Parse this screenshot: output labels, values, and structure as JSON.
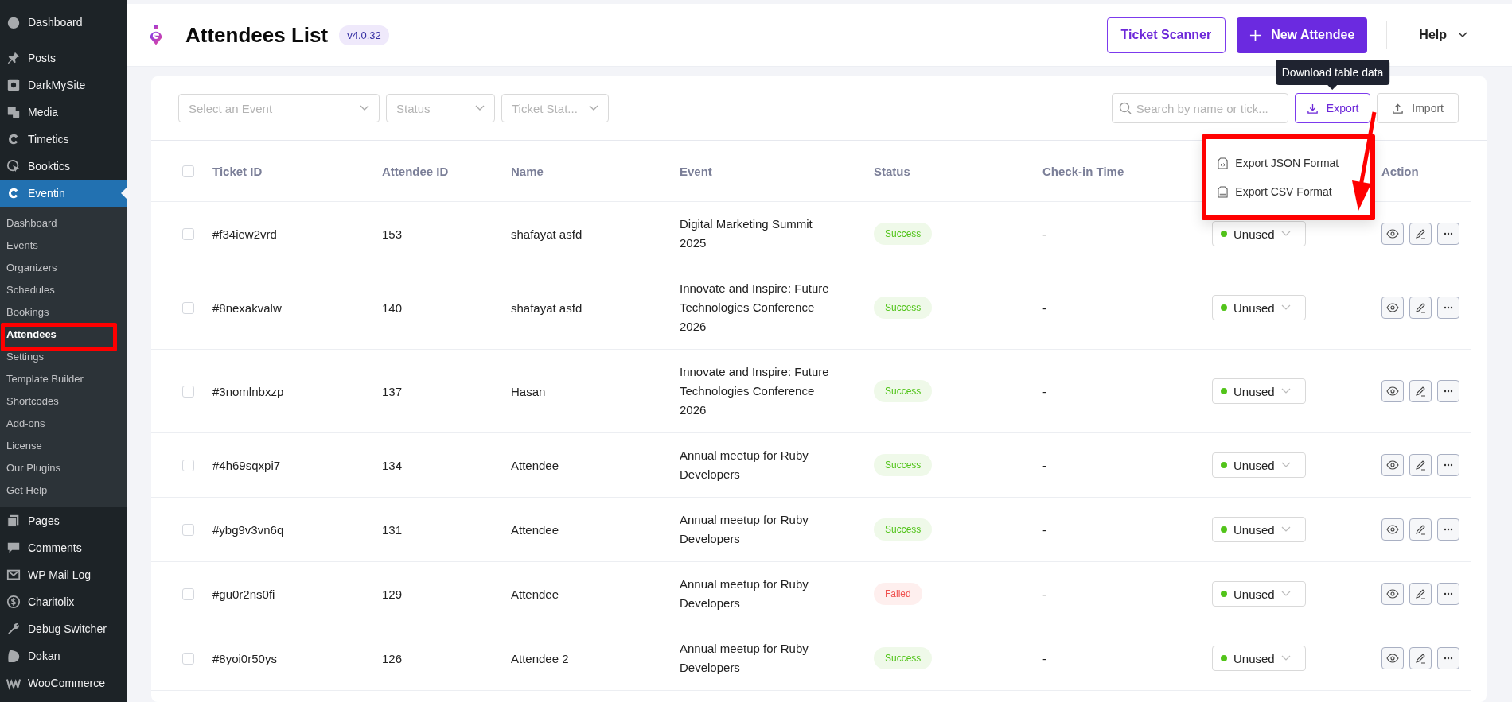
{
  "sidebar": {
    "items": [
      {
        "label": "Dashboard",
        "selected": false
      },
      {
        "label": "Posts",
        "selected": false
      },
      {
        "label": "DarkMySite",
        "selected": false
      },
      {
        "label": "Media",
        "selected": false
      },
      {
        "label": "Timetics",
        "selected": false
      },
      {
        "label": "Booktics",
        "selected": false
      },
      {
        "label": "Eventin",
        "selected": true,
        "children": [
          {
            "label": "Dashboard",
            "selected": false,
            "annotated": false
          },
          {
            "label": "Events",
            "selected": false,
            "annotated": false
          },
          {
            "label": "Organizers",
            "selected": false,
            "annotated": false
          },
          {
            "label": "Schedules",
            "selected": false,
            "annotated": false
          },
          {
            "label": "Bookings",
            "selected": false,
            "annotated": false
          },
          {
            "label": "Attendees",
            "selected": true,
            "annotated": true
          },
          {
            "label": "Settings",
            "selected": false,
            "annotated": false
          },
          {
            "label": "Template Builder",
            "selected": false,
            "annotated": false
          },
          {
            "label": "Shortcodes",
            "selected": false,
            "annotated": false
          },
          {
            "label": "Add-ons",
            "selected": false,
            "annotated": false
          },
          {
            "label": "License",
            "selected": false,
            "annotated": false
          },
          {
            "label": "Our Plugins",
            "selected": false,
            "annotated": false
          },
          {
            "label": "Get Help",
            "selected": false,
            "annotated": false
          }
        ]
      },
      {
        "label": "Pages",
        "selected": false
      },
      {
        "label": "Comments",
        "selected": false
      },
      {
        "label": "WP Mail Log",
        "selected": false
      },
      {
        "label": "Charitolix",
        "selected": false
      },
      {
        "label": "Debug Switcher",
        "selected": false
      },
      {
        "label": "Dokan",
        "selected": false
      },
      {
        "label": "WooCommerce",
        "selected": false
      }
    ]
  },
  "header": {
    "title": "Attendees List",
    "version": "v4.0.32",
    "scanner_button": "Ticket Scanner",
    "new_button": "New Attendee",
    "help": "Help"
  },
  "toolbar": {
    "filters": [
      {
        "placeholder": "Select an Event"
      },
      {
        "placeholder": "Status"
      },
      {
        "placeholder": "Ticket Stat..."
      }
    ],
    "search": {
      "placeholder": "Search by name or tick..."
    },
    "export": {
      "label": "Export",
      "tooltip": "Download table data",
      "menu": {
        "annotated": true,
        "items": [
          {
            "kind": "json",
            "label": "Export JSON Format"
          },
          {
            "kind": "csv",
            "label": "Export CSV Format"
          }
        ]
      }
    },
    "import": {
      "label": "Import"
    }
  },
  "table": {
    "header_checked": false,
    "columns": [
      {
        "label": "Ticket ID"
      },
      {
        "label": "Attendee ID"
      },
      {
        "label": "Name"
      },
      {
        "label": "Event"
      },
      {
        "label": "Status"
      },
      {
        "label": "Check-in Time"
      },
      {
        "label": "Action"
      }
    ],
    "rows": [
      {
        "checked": false,
        "ticket_id": "#f34iew2vrd",
        "attendee_id": "153",
        "name": "shafayat asfd",
        "event": "Digital Marketing Summit 2025",
        "status": "Success",
        "color": "#52c41a",
        "check_in": "-",
        "ticket_status": "Unused"
      },
      {
        "checked": false,
        "ticket_id": "#8nexakvalw",
        "attendee_id": "140",
        "name": "shafayat asfd",
        "event": "Innovate and Inspire: Future Technologies Conference 2026",
        "status": "Success",
        "color": "#52c41a",
        "check_in": "-",
        "ticket_status": "Unused"
      },
      {
        "checked": false,
        "ticket_id": "#3nomlnbxzp",
        "attendee_id": "137",
        "name": "Hasan",
        "event": "Innovate and Inspire: Future Technologies Conference 2026",
        "status": "Success",
        "color": "#52c41a",
        "check_in": "-",
        "ticket_status": "Unused"
      },
      {
        "checked": false,
        "ticket_id": "#4h69sqxpi7",
        "attendee_id": "134",
        "name": "Attendee",
        "event": "Annual meetup for Ruby Developers",
        "status": "Success",
        "color": "#52c41a",
        "check_in": "-",
        "ticket_status": "Unused"
      },
      {
        "checked": false,
        "ticket_id": "#ybg9v3vn6q",
        "attendee_id": "131",
        "name": "Attendee",
        "event": "Annual meetup for Ruby Developers",
        "status": "Success",
        "color": "#52c41a",
        "check_in": "-",
        "ticket_status": "Unused"
      },
      {
        "checked": false,
        "ticket_id": "#gu0r2ns0fi",
        "attendee_id": "129",
        "name": "Attendee",
        "event": "Annual meetup for Ruby Developers",
        "status": "Failed",
        "color": "#f0524f",
        "check_in": "-",
        "ticket_status": "Unused"
      },
      {
        "checked": false,
        "ticket_id": "#8yoi0r50ys",
        "attendee_id": "126",
        "name": "Attendee 2",
        "event": "Annual meetup for Ruby Developers",
        "status": "Success",
        "color": "#52c41a",
        "check_in": "-",
        "ticket_status": "Unused"
      }
    ]
  }
}
